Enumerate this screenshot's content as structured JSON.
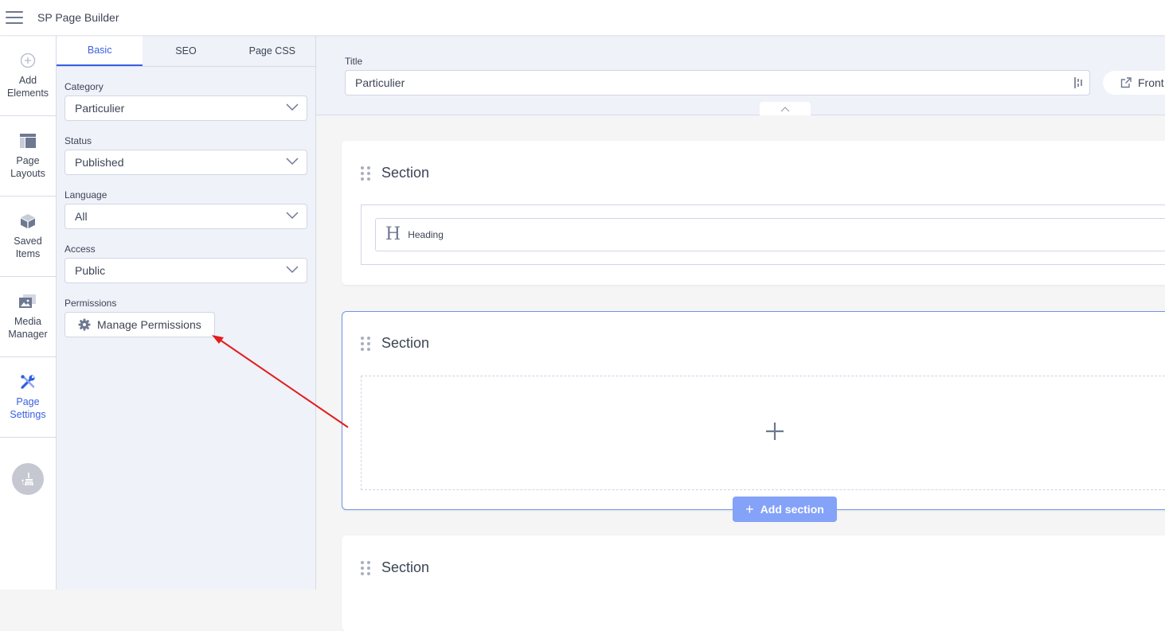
{
  "app": {
    "title": "SP Page Builder"
  },
  "rail": {
    "items": [
      {
        "label_line1": "Add",
        "label_line2": "Elements",
        "icon": "plus-circle-icon",
        "active": false
      },
      {
        "label_line1": "Page",
        "label_line2": "Layouts",
        "icon": "layout-icon",
        "active": false
      },
      {
        "label_line1": "Saved",
        "label_line2": "Items",
        "icon": "cube-icon",
        "active": false
      },
      {
        "label_line1": "Media",
        "label_line2": "Manager",
        "icon": "media-icon",
        "active": false
      },
      {
        "label_line1": "Page",
        "label_line2": "Settings",
        "icon": "tools-icon",
        "active": true
      }
    ],
    "clean_icon": "broom-icon"
  },
  "panel": {
    "tabs": [
      {
        "label": "Basic",
        "active": true
      },
      {
        "label": "SEO",
        "active": false
      },
      {
        "label": "Page CSS",
        "active": false
      }
    ],
    "fields": {
      "category": {
        "label": "Category",
        "value": "Particulier"
      },
      "status": {
        "label": "Status",
        "value": "Published"
      },
      "language": {
        "label": "Language",
        "value": "All"
      },
      "access": {
        "label": "Access",
        "value": "Public"
      }
    },
    "permissions": {
      "label": "Permissions",
      "button": "Manage Permissions"
    }
  },
  "main": {
    "title_label": "Title",
    "title_value": "Particulier",
    "front_button": "Front",
    "sections": [
      {
        "title": "Section",
        "addons": [
          {
            "name": "Heading",
            "icon": "H"
          }
        ]
      },
      {
        "title": "Section",
        "addons": []
      },
      {
        "title": "Section",
        "addons": []
      }
    ],
    "add_section_label": "Add section"
  },
  "colors": {
    "accent": "#3a5fe0",
    "add_section_bg": "#84a2f8",
    "annotation_arrow": "#e31c1c"
  }
}
